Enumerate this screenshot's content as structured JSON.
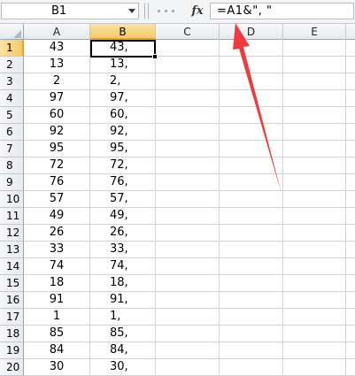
{
  "name_box": {
    "value": "B1"
  },
  "formula_bar": {
    "fx_label": "fx",
    "formula": "=A1&\", \""
  },
  "columns": [
    "A",
    "B",
    "C",
    "D",
    "E"
  ],
  "rows": [
    {
      "num": "1",
      "a": "43",
      "b": "43,"
    },
    {
      "num": "2",
      "a": "13",
      "b": "13,"
    },
    {
      "num": "3",
      "a": "2",
      "b": "2,"
    },
    {
      "num": "4",
      "a": "97",
      "b": "97,"
    },
    {
      "num": "5",
      "a": "60",
      "b": "60,"
    },
    {
      "num": "6",
      "a": "92",
      "b": "92,"
    },
    {
      "num": "7",
      "a": "95",
      "b": "95,"
    },
    {
      "num": "8",
      "a": "72",
      "b": "72,"
    },
    {
      "num": "9",
      "a": "76",
      "b": "76,"
    },
    {
      "num": "10",
      "a": "57",
      "b": "57,"
    },
    {
      "num": "11",
      "a": "49",
      "b": "49,"
    },
    {
      "num": "12",
      "a": "26",
      "b": "26,"
    },
    {
      "num": "13",
      "a": "33",
      "b": "33,"
    },
    {
      "num": "14",
      "a": "74",
      "b": "74,"
    },
    {
      "num": "15",
      "a": "18",
      "b": "18,"
    },
    {
      "num": "16",
      "a": "91",
      "b": "91,"
    },
    {
      "num": "17",
      "a": "1",
      "b": "1,"
    },
    {
      "num": "18",
      "a": "85",
      "b": "85,"
    },
    {
      "num": "19",
      "a": "84",
      "b": "84,"
    },
    {
      "num": "20",
      "a": "30",
      "b": "30,"
    }
  ],
  "active_cell": "B1",
  "annotation": {
    "color": "#ee3b3b",
    "icon": "red-arrow-icon"
  }
}
